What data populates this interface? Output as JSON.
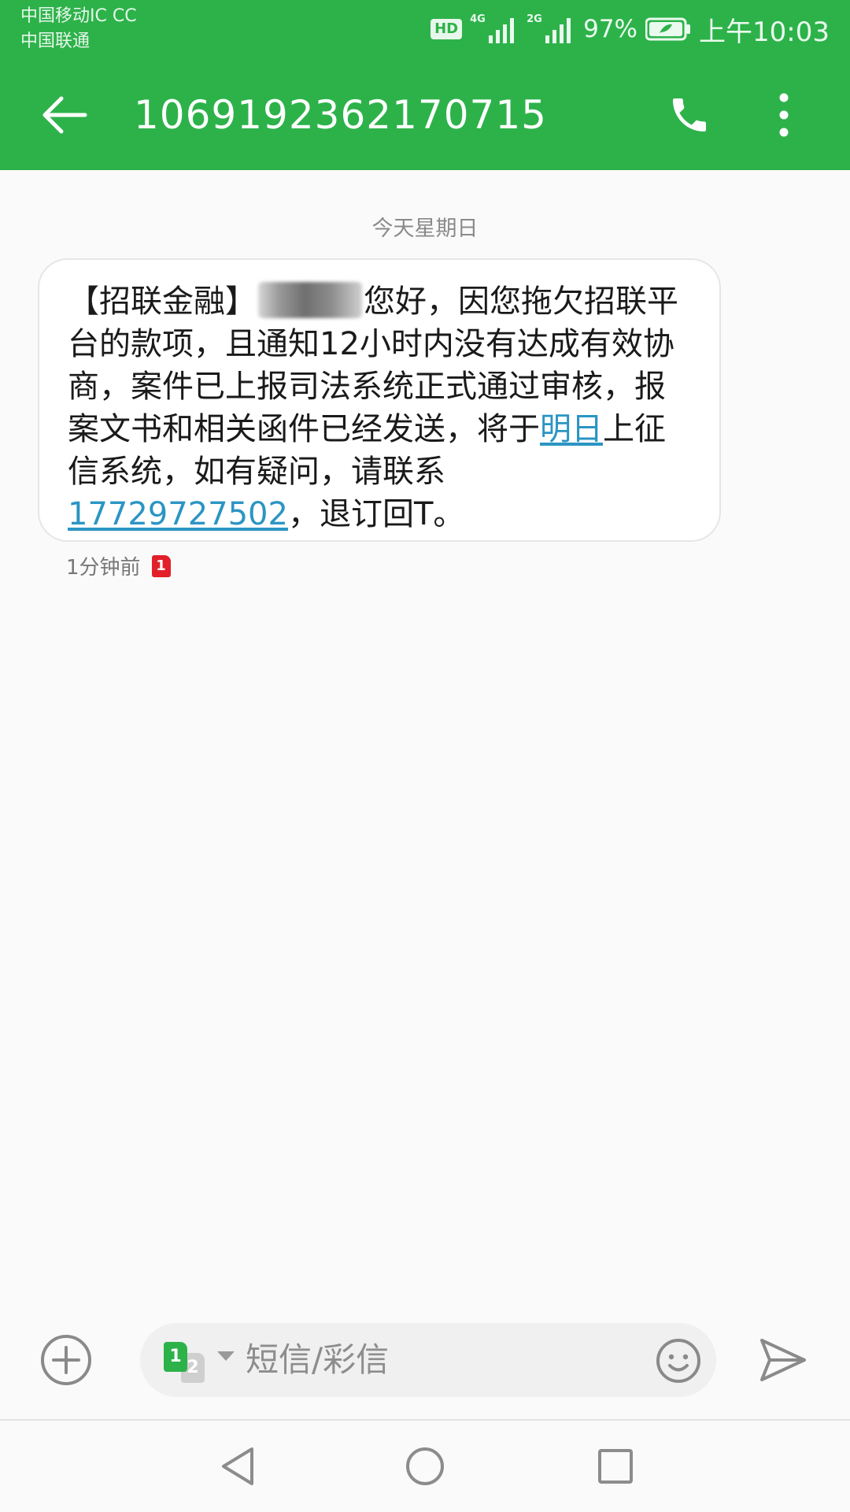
{
  "status_bar": {
    "carrier_1": "中国移动IC CC",
    "carrier_2": "中国联通",
    "hd": "HD",
    "net_1": "4G",
    "net_2": "2G",
    "battery": "97%",
    "time": "上午10:03"
  },
  "header": {
    "title": "1069192362170715",
    "icons": [
      "back-arrow-icon",
      "phone-icon",
      "more-vertical-icon"
    ]
  },
  "conversation": {
    "date_separator": "今天星期日",
    "message": {
      "seg_1": "【招联金融】",
      "seg_2": "您好，因您拖欠招联平台的款项，且通知12小时内没有达成有效协商，案件已上报司法系统正式通过审核，报案文书和相关函件已经发送，将于",
      "link_date": "明日",
      "seg_3": "上征信系统，如有疑问，请联系",
      "link_phone": "17729727502",
      "seg_4": "，退订回T。"
    },
    "meta_time": "1分钟前",
    "sim_badge": "1"
  },
  "composer": {
    "sim_1": "1",
    "sim_2": "2",
    "placeholder": "短信/彩信",
    "icons": [
      "add-circle-icon",
      "emoji-icon",
      "send-icon"
    ]
  },
  "navbar": {
    "icons": [
      "nav-back-icon",
      "nav-home-icon",
      "nav-recent-icon"
    ]
  },
  "colors": {
    "primary": "#2db24a",
    "link": "#2b95c3",
    "sim_badge": "#e1202a"
  }
}
